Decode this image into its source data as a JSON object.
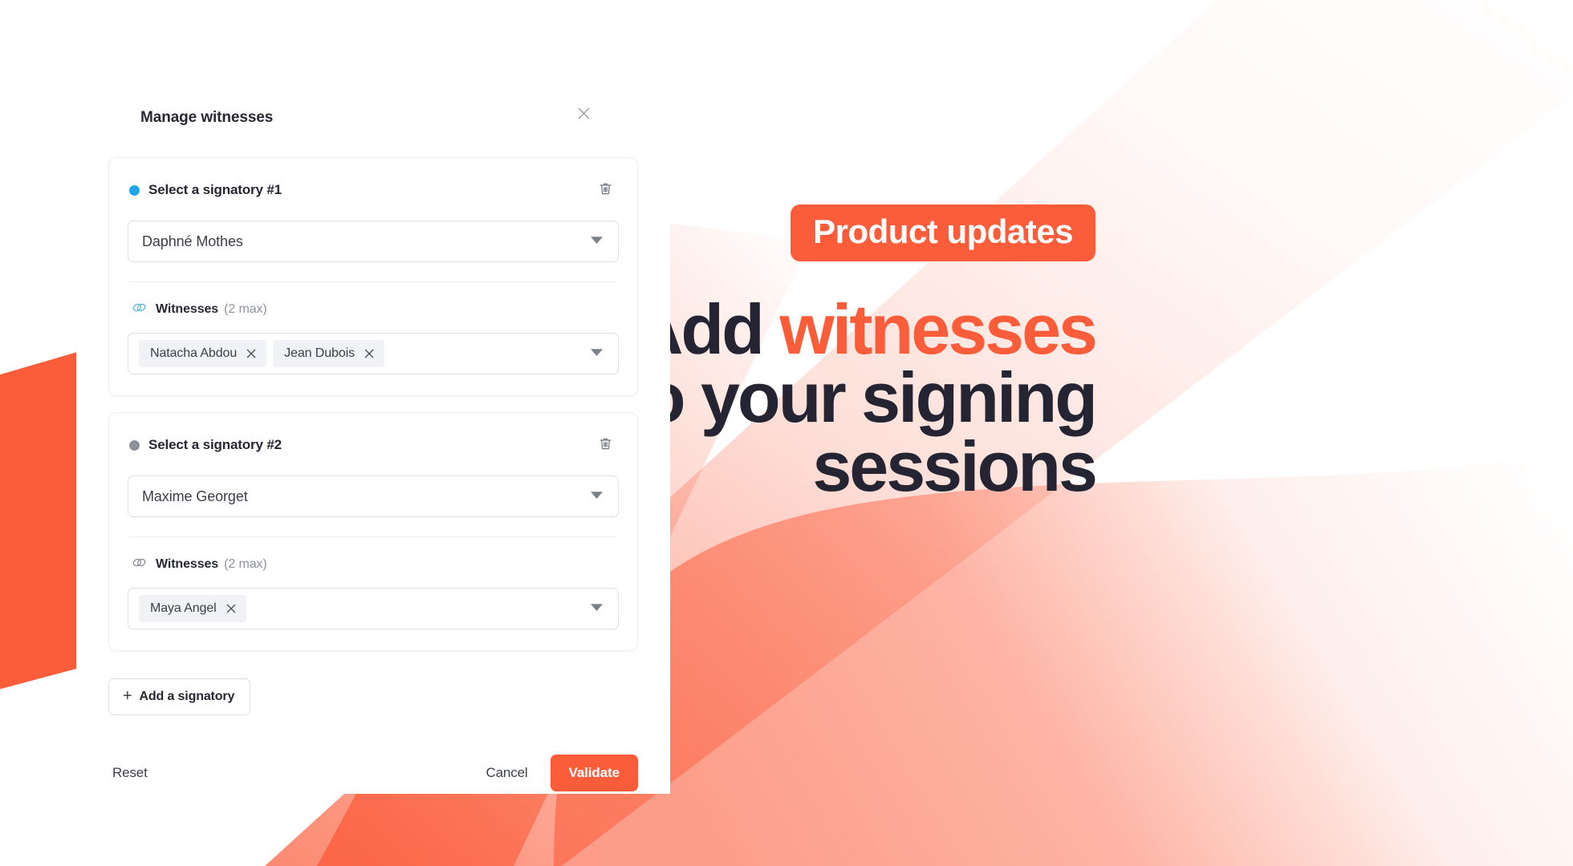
{
  "background": {
    "accent_orange": "#fb5c3a",
    "accent_peach": "#fda584",
    "page_bg": "#ffffff"
  },
  "marketing": {
    "badge": "Product updates",
    "headline_line1_plain": "Add ",
    "headline_line1_accent": "witnesses",
    "headline_line2": "to your signing",
    "headline_line3": "sessions",
    "accent_color": "#fb5c3a",
    "text_color": "#242433"
  },
  "modal": {
    "title": "Manage witnesses",
    "close_icon": "close-icon",
    "cards": [
      {
        "status_color": "#1ea7e8",
        "label": "Select a signatory #1",
        "delete_icon": "trash-icon",
        "signatory_value": "Daphné Mothes",
        "caret_icon": "chevron-down-icon",
        "witness_icon": "link-icon",
        "witness_icon_color": "#5fb8d8",
        "witness_label": "Witnesses",
        "witness_max": "(2 max)",
        "witness_chips": [
          {
            "name": "Natacha Abdou",
            "remove_icon": "close-icon"
          },
          {
            "name": "Jean Dubois",
            "remove_icon": "close-icon"
          }
        ]
      },
      {
        "status_color": "#8c919c",
        "label": "Select a signatory #2",
        "delete_icon": "trash-icon",
        "signatory_value": "Maxime Georget",
        "caret_icon": "chevron-down-icon",
        "witness_icon": "link-icon",
        "witness_icon_color": "#8c919c",
        "witness_label": "Witnesses",
        "witness_max": "(2 max)",
        "witness_chips": [
          {
            "name": "Maya Angel",
            "remove_icon": "close-icon"
          }
        ]
      }
    ],
    "add_signatory": {
      "plus": "+",
      "label": "Add a signatory"
    },
    "footer": {
      "reset_label": "Reset",
      "cancel_label": "Cancel",
      "validate_label": "Validate",
      "validate_color": "#fb5c3a"
    }
  }
}
